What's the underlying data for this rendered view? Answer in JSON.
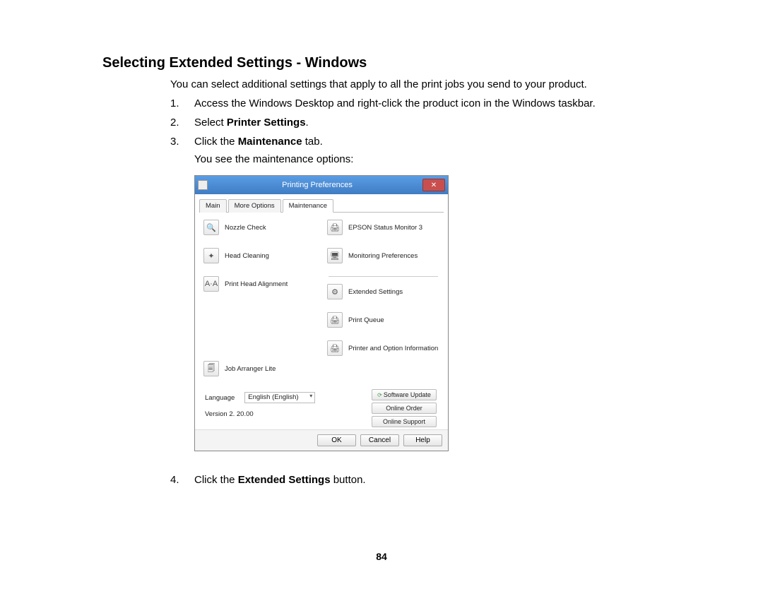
{
  "heading": "Selecting Extended Settings - Windows",
  "intro": "You can select additional settings that apply to all the print jobs you send to your product.",
  "steps": {
    "s1": "Access the Windows Desktop and right-click the product icon in the Windows taskbar.",
    "s2_pre": "Select ",
    "s2_bold": "Printer Settings",
    "s2_post": ".",
    "s3_pre": "Click the ",
    "s3_bold": "Maintenance",
    "s3_post": " tab.",
    "s3_follow": "You see the maintenance options:",
    "s4_pre": "Click the ",
    "s4_bold": "Extended Settings",
    "s4_post": " button."
  },
  "dialog": {
    "title": "Printing Preferences",
    "close_glyph": "✕",
    "tabs": {
      "main": "Main",
      "more": "More Options",
      "maint": "Maintenance"
    },
    "left": {
      "nozzle": "Nozzle Check",
      "head_clean": "Head Cleaning",
      "align": "Print Head Alignment",
      "job_arr": "Job Arranger Lite"
    },
    "right": {
      "status_mon": "EPSON Status Monitor 3",
      "mon_pref": "Monitoring Preferences",
      "ext": "Extended Settings",
      "queue": "Print Queue",
      "printer_opt": "Printer and Option Information"
    },
    "lang_label": "Language",
    "lang_value": "English (English)",
    "version": "Version 2. 20.00",
    "btns": {
      "sw_update": "Software Update",
      "online_order": "Online Order",
      "online_support": "Online Support"
    },
    "footer": {
      "ok": "OK",
      "cancel": "Cancel",
      "help": "Help"
    }
  },
  "page_number": "84"
}
